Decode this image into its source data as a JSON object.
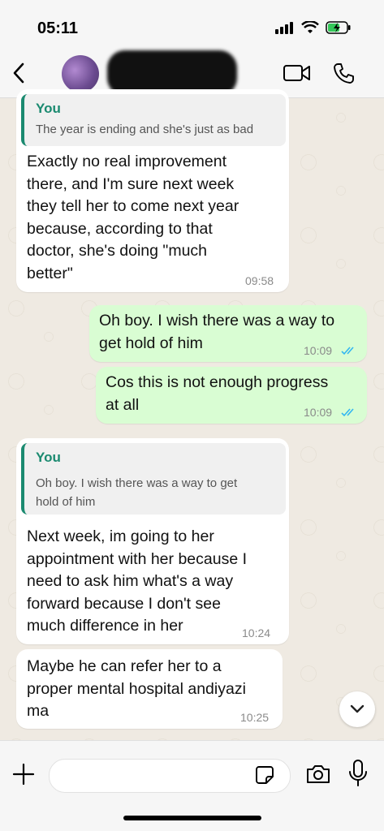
{
  "status_bar": {
    "time": "05:11"
  },
  "header": {
    "contact_name": ""
  },
  "messages": [
    {
      "direction": "in",
      "quote_author": "You",
      "quote_text": "The year is ending and she's just as bad",
      "lines": [
        "Exactly no real improvement",
        "there, and I'm sure next week",
        "they tell her to come next year",
        "because, according to that",
        "doctor, she's doing \"much",
        "better\""
      ],
      "time": "09:58"
    },
    {
      "direction": "out",
      "lines": [
        "Oh boy. I wish there was a way to",
        "get hold of him"
      ],
      "time": "10:09"
    },
    {
      "direction": "out",
      "lines": [
        "Cos this is not enough progress",
        "at all"
      ],
      "time": "10:09"
    },
    {
      "direction": "in",
      "quote_author": "You",
      "quote_lines": [
        "Oh boy. I wish there was a way to get",
        "hold of him"
      ],
      "lines": [
        "Next week, im going to her",
        "appointment with her because I",
        "need to ask him what's  a way",
        "forward because I don't see",
        "much difference in her"
      ],
      "time": "10:24"
    },
    {
      "direction": "in",
      "lines": [
        "Maybe he can refer her to a",
        "proper mental hospital andiyazi",
        "ma"
      ],
      "time": "10:25"
    }
  ],
  "composer": {
    "placeholder": ""
  },
  "colors": {
    "outgoing": "#d9fdd3",
    "incoming": "#ffffff",
    "accent": "#1b8a70",
    "read_ticks": "#34b7f1"
  }
}
